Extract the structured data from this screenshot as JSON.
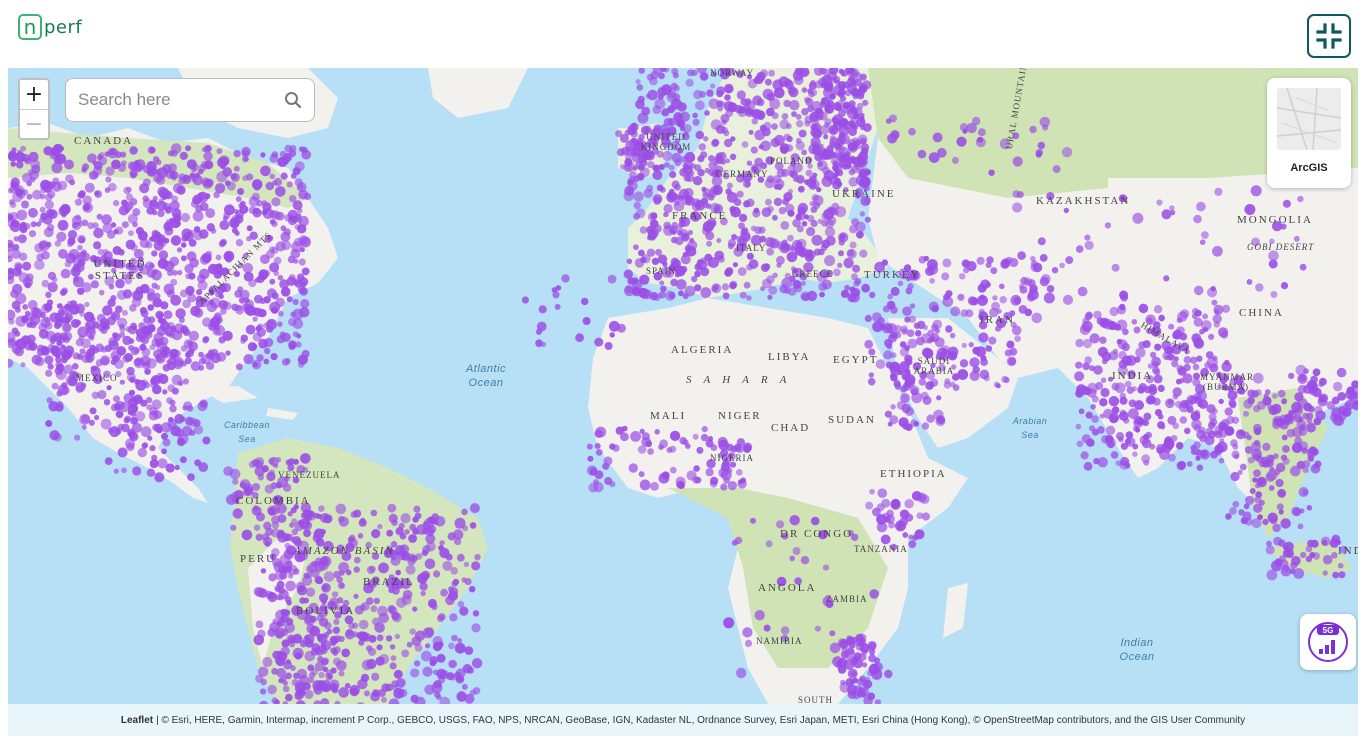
{
  "brand": {
    "logo_bracket": "n",
    "logo_word": "perf"
  },
  "search": {
    "placeholder": "Search here"
  },
  "zoom": {
    "in_label": "+",
    "out_label": "−"
  },
  "basemap": {
    "label": "ArcGIS"
  },
  "network": {
    "badge": "5G"
  },
  "colors": {
    "coverage": "#9b4ee6",
    "ocean": "#b7dff5",
    "land": "#f2f1ee",
    "vegetation": "#cfe3b4",
    "brand": "#0e5a5a"
  },
  "attribution": {
    "leaflet": "Leaflet",
    "text": "| © Esri, HERE, Garmin, Intermap, increment P Corp., GEBCO, USGS, FAO, NPS, NRCAN, GeoBase, IGN, Kadaster NL, Ordnance Survey, Esri Japan, METI, Esri China (Hong Kong), © OpenStreetMap contributors, and the GIS User Community"
  },
  "labels": {
    "canada": "CANADA",
    "united_states": "UNITED STATES",
    "appalachian": "APPALACHIAN MTS",
    "mexico": "MEXICO",
    "caribbean": "Caribbean Sea",
    "venezuela": "VENEZUELA",
    "colombia": "COLOMBIA",
    "amazon": "AMAZON BASIN",
    "peru": "PERU",
    "brazil": "BRAZIL",
    "bolivia": "BOLIVIA",
    "atlantic": "Atlantic Ocean",
    "norway": "NORWAY",
    "uk": "UNITED KINGDOM",
    "germany": "GERMANY",
    "poland": "POLAND",
    "france": "FRANCE",
    "ukraine": "UKRAINE",
    "italy": "ITALY",
    "spain": "SPAIN",
    "greece": "GREECE",
    "turkey": "TURKEY",
    "algeria": "ALGERIA",
    "libya": "LIBYA",
    "egypt": "EGYPT",
    "sahara": "SAHARA",
    "mali": "MALI",
    "niger": "NIGER",
    "chad": "CHAD",
    "sudan": "SUDAN",
    "nigeria": "NIGERIA",
    "ethiopia": "ETHIOPIA",
    "dr_congo": "DR CONGO",
    "tanzania": "TANZANIA",
    "angola": "ANGOLA",
    "zambia": "ZAMBIA",
    "namibia": "NAMIBIA",
    "south_africa": "SOUTH",
    "iran": "IRAN",
    "saudi": "SAUDI ARABIA",
    "arabian_sea": "Arabian Sea",
    "kazakhstan": "KAZAKHSTAN",
    "ural": "URAL MOUNTAINS",
    "mongolia": "MONGOLIA",
    "gobi": "GOBI DESERT",
    "china": "CHINA",
    "himalaya": "HIMALAYA",
    "india": "INDIA",
    "myanmar": "MYANMAR (BURMA)",
    "indian_ocean": "Indian Ocean",
    "ind": "IND"
  }
}
